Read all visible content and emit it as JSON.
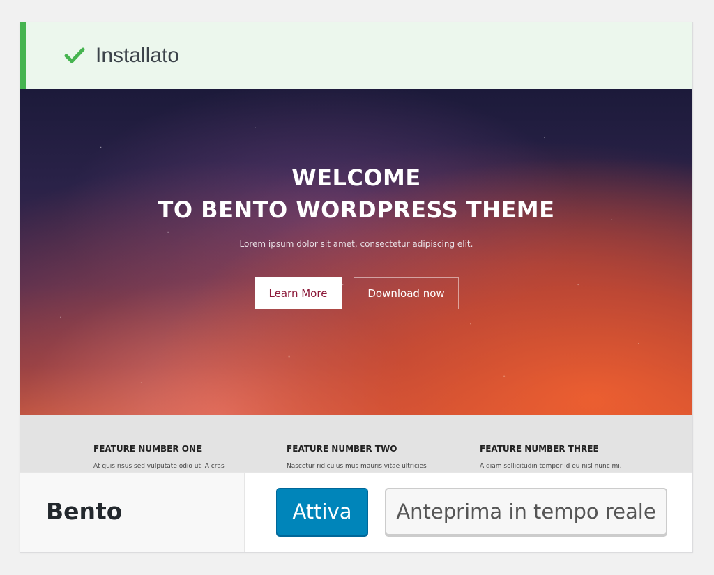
{
  "notice": {
    "icon": "check-icon",
    "color": "#46b450",
    "label": "Installato"
  },
  "preview": {
    "hero": {
      "title_line1": "WELCOME",
      "title_line2": "TO BENTO WORDPRESS THEME",
      "subtitle": "Lorem ipsum dolor sit amet, consectetur adipiscing elit.",
      "learn_more": "Learn More",
      "download_now": "Download now"
    },
    "features": [
      {
        "title": "FEATURE NUMBER ONE",
        "text": "At quis risus sed vulputate odio ut. A cras"
      },
      {
        "title": "FEATURE NUMBER TWO",
        "text": "Nascetur ridiculus mus mauris vitae ultricies"
      },
      {
        "title": "FEATURE NUMBER THREE",
        "text": "A diam sollicitudin tempor id eu nisl nunc mi."
      }
    ]
  },
  "theme": {
    "name": "Bento",
    "activate_label": "Attiva",
    "live_preview_label": "Anteprima in tempo reale",
    "accent_color": "#0085ba"
  }
}
